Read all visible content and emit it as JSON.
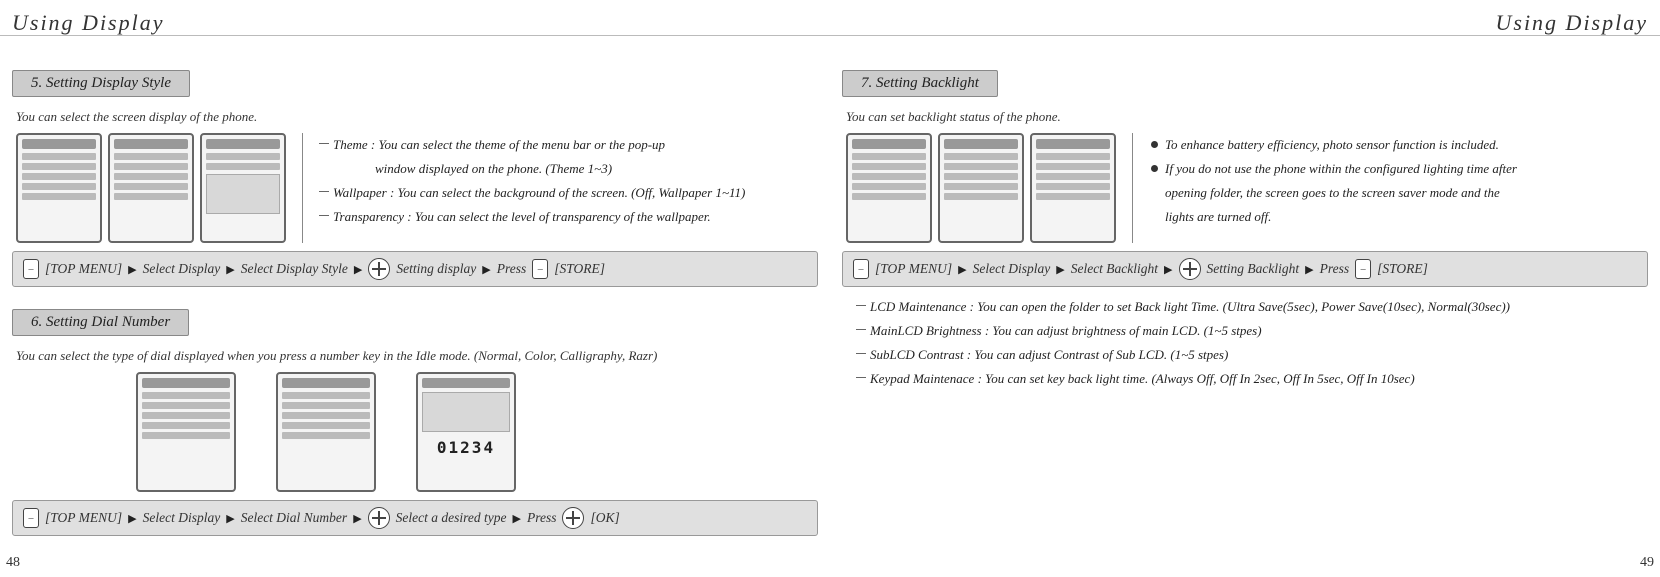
{
  "left": {
    "title": "Using Display",
    "page_num": "48",
    "sec5": {
      "heading": "5. Setting Display Style",
      "intro": "You can select the screen display of the phone.",
      "items": {
        "theme1": "Theme : You can select the theme of the menu bar or the pop-up",
        "theme2": "window displayed on the phone. (Theme 1~3)",
        "wallpaper": "Wallpaper : You can select the background of the screen. (Off, Wallpaper 1~11)",
        "transparency": "Transparency : You can select the level of transparency of the wallpaper."
      },
      "nav": {
        "top": "[TOP MENU]",
        "a": "Select Display",
        "b": "Select Display Style",
        "c": "Setting display",
        "d": "Press",
        "store": "[STORE]"
      }
    },
    "sec6": {
      "heading": "6. Setting Dial Number",
      "intro": "You can select the type of dial displayed when you press a number key in the Idle mode. (Normal, Color, Calligraphy, Razr)",
      "digits": "01234",
      "nav": {
        "top": "[TOP MENU]",
        "a": "Select Display",
        "b": "Select Dial Number",
        "c": "Select a desired type",
        "d": "Press",
        "ok": "[OK]"
      }
    }
  },
  "right": {
    "title": "Using Display",
    "page_num": "49",
    "sec7": {
      "heading": "7. Setting Backlight",
      "intro": "You can set backlight status of the phone.",
      "bullets": {
        "b1": "To enhance battery efficiency, photo sensor function is included.",
        "b2a": "If you do not use the phone within the configured lighting time after",
        "b2b": "opening folder, the screen goes to the screen saver mode and the",
        "b2c": "lights are turned off."
      },
      "nav": {
        "top": "[TOP MENU]",
        "a": "Select Display",
        "b": "Select Backlight",
        "c": "Setting Backlight",
        "d": "Press",
        "store": "[STORE]"
      },
      "sub": {
        "lcd": "LCD Maintenance : You can open the folder to set Back light Time. (Ultra Save(5sec), Power Save(10sec), Normal(30sec))",
        "main": "MainLCD Brightness : You can adjust brightness of main LCD. (1~5 stpes)",
        "subc": "SubLCD Contrast : You can adjust Contrast of Sub LCD. (1~5 stpes)",
        "keypad": "Keypad Maintenace : You can set key back light time. (Always Off, Off In 2sec, Off In 5sec, Off In 10sec)"
      }
    }
  }
}
